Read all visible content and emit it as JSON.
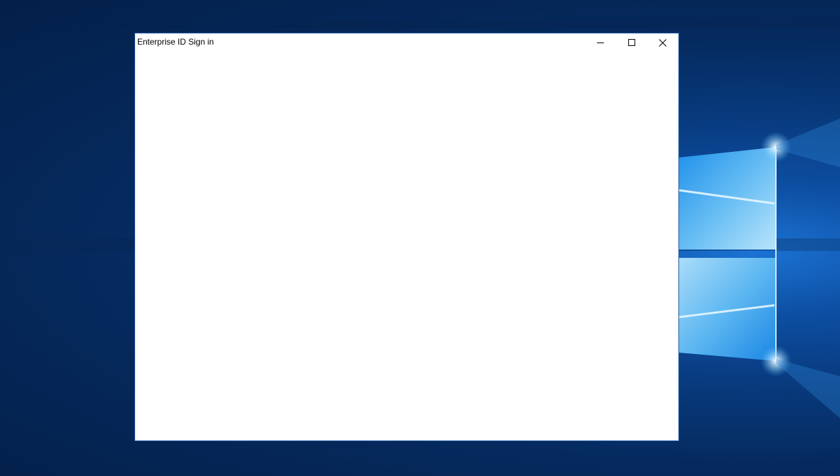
{
  "window": {
    "title": "Enterprise ID Sign in",
    "controls": {
      "minimize_icon": "minimize-icon",
      "maximize_icon": "maximize-icon",
      "close_icon": "close-icon"
    }
  },
  "desktop": {
    "wallpaper": "windows-10-hero",
    "colors": {
      "background_dark": "#041f49",
      "background_mid": "#0d4fa3",
      "logo_light": "#7cc6f5",
      "logo_bright": "#e8f7ff"
    }
  }
}
